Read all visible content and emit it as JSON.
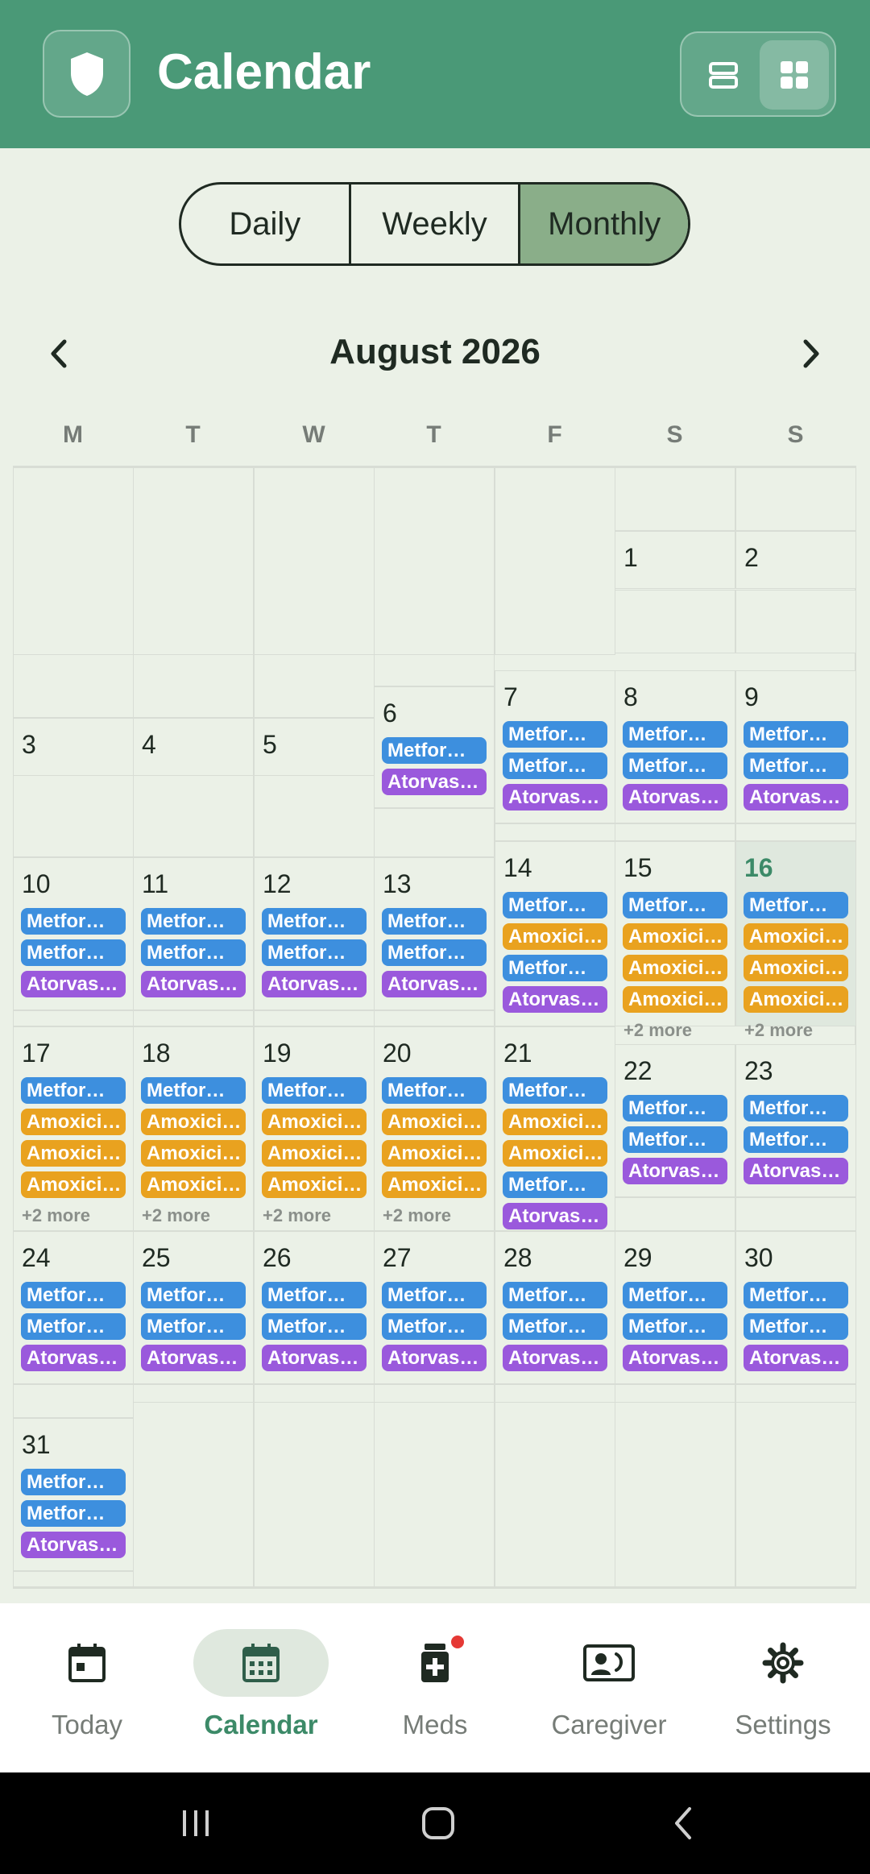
{
  "header": {
    "title": "Calendar",
    "logo_icon": "shield-icon",
    "view_toggle": [
      {
        "icon": "list-view-icon",
        "active": false
      },
      {
        "icon": "grid-view-icon",
        "active": true
      }
    ]
  },
  "segmented": {
    "options": [
      "Daily",
      "Weekly",
      "Monthly"
    ],
    "selected": "Monthly"
  },
  "month_nav": {
    "title": "August 2026",
    "prev_icon": "chevron-left-icon",
    "next_icon": "chevron-right-icon"
  },
  "weekdays": [
    "M",
    "T",
    "W",
    "T",
    "F",
    "S",
    "S"
  ],
  "colors": {
    "header": "#4a9977",
    "background": "#ebf1e7",
    "metformin": "#3d8fde",
    "amoxicillin": "#e9a21f",
    "atorvastatin": "#9a59dc",
    "today": "#3c8a68"
  },
  "calendar": {
    "today": "16",
    "days": [
      {
        "day": "1",
        "pills": [],
        "more": ""
      },
      {
        "day": "2",
        "pills": [],
        "more": ""
      },
      {
        "day": "3",
        "pills": [],
        "more": ""
      },
      {
        "day": "4",
        "pills": [],
        "more": ""
      },
      {
        "day": "5",
        "pills": [],
        "more": ""
      },
      {
        "day": "6",
        "pills": [
          {
            "label": "Metfor…",
            "color": "blue"
          },
          {
            "label": "Atorvas…",
            "color": "purple"
          }
        ],
        "more": ""
      },
      {
        "day": "7",
        "pills": [
          {
            "label": "Metfor…",
            "color": "blue"
          },
          {
            "label": "Metfor…",
            "color": "blue"
          },
          {
            "label": "Atorvas…",
            "color": "purple"
          }
        ],
        "more": ""
      },
      {
        "day": "8",
        "pills": [
          {
            "label": "Metfor…",
            "color": "blue"
          },
          {
            "label": "Metfor…",
            "color": "blue"
          },
          {
            "label": "Atorvas…",
            "color": "purple"
          }
        ],
        "more": ""
      },
      {
        "day": "9",
        "pills": [
          {
            "label": "Metfor…",
            "color": "blue"
          },
          {
            "label": "Metfor…",
            "color": "blue"
          },
          {
            "label": "Atorvas…",
            "color": "purple"
          }
        ],
        "more": ""
      },
      {
        "day": "10",
        "pills": [
          {
            "label": "Metfor…",
            "color": "blue"
          },
          {
            "label": "Metfor…",
            "color": "blue"
          },
          {
            "label": "Atorvas…",
            "color": "purple"
          }
        ],
        "more": ""
      },
      {
        "day": "11",
        "pills": [
          {
            "label": "Metfor…",
            "color": "blue"
          },
          {
            "label": "Metfor…",
            "color": "blue"
          },
          {
            "label": "Atorvas…",
            "color": "purple"
          }
        ],
        "more": ""
      },
      {
        "day": "12",
        "pills": [
          {
            "label": "Metfor…",
            "color": "blue"
          },
          {
            "label": "Metfor…",
            "color": "blue"
          },
          {
            "label": "Atorvas…",
            "color": "purple"
          }
        ],
        "more": ""
      },
      {
        "day": "13",
        "pills": [
          {
            "label": "Metfor…",
            "color": "blue"
          },
          {
            "label": "Metfor…",
            "color": "blue"
          },
          {
            "label": "Atorvas…",
            "color": "purple"
          }
        ],
        "more": ""
      },
      {
        "day": "14",
        "pills": [
          {
            "label": "Metfor…",
            "color": "blue"
          },
          {
            "label": "Amoxici…",
            "color": "orange"
          },
          {
            "label": "Metfor…",
            "color": "blue"
          },
          {
            "label": "Atorvas…",
            "color": "purple"
          }
        ],
        "more": ""
      },
      {
        "day": "15",
        "pills": [
          {
            "label": "Metfor…",
            "color": "blue"
          },
          {
            "label": "Amoxici…",
            "color": "orange"
          },
          {
            "label": "Amoxici…",
            "color": "orange"
          },
          {
            "label": "Amoxici…",
            "color": "orange"
          }
        ],
        "more": "+2 more"
      },
      {
        "day": "16",
        "pills": [
          {
            "label": "Metfor…",
            "color": "blue"
          },
          {
            "label": "Amoxici…",
            "color": "orange"
          },
          {
            "label": "Amoxici…",
            "color": "orange"
          },
          {
            "label": "Amoxici…",
            "color": "orange"
          }
        ],
        "more": "+2 more"
      },
      {
        "day": "17",
        "pills": [
          {
            "label": "Metfor…",
            "color": "blue"
          },
          {
            "label": "Amoxici…",
            "color": "orange"
          },
          {
            "label": "Amoxici…",
            "color": "orange"
          },
          {
            "label": "Amoxici…",
            "color": "orange"
          }
        ],
        "more": "+2 more"
      },
      {
        "day": "18",
        "pills": [
          {
            "label": "Metfor…",
            "color": "blue"
          },
          {
            "label": "Amoxici…",
            "color": "orange"
          },
          {
            "label": "Amoxici…",
            "color": "orange"
          },
          {
            "label": "Amoxici…",
            "color": "orange"
          }
        ],
        "more": "+2 more"
      },
      {
        "day": "19",
        "pills": [
          {
            "label": "Metfor…",
            "color": "blue"
          },
          {
            "label": "Amoxici…",
            "color": "orange"
          },
          {
            "label": "Amoxici…",
            "color": "orange"
          },
          {
            "label": "Amoxici…",
            "color": "orange"
          }
        ],
        "more": "+2 more"
      },
      {
        "day": "20",
        "pills": [
          {
            "label": "Metfor…",
            "color": "blue"
          },
          {
            "label": "Amoxici…",
            "color": "orange"
          },
          {
            "label": "Amoxici…",
            "color": "orange"
          },
          {
            "label": "Amoxici…",
            "color": "orange"
          }
        ],
        "more": "+2 more"
      },
      {
        "day": "21",
        "pills": [
          {
            "label": "Metfor…",
            "color": "blue"
          },
          {
            "label": "Amoxici…",
            "color": "orange"
          },
          {
            "label": "Amoxici…",
            "color": "orange"
          },
          {
            "label": "Metfor…",
            "color": "blue"
          },
          {
            "label": "Atorvas…",
            "color": "purple"
          }
        ],
        "more": ""
      },
      {
        "day": "22",
        "pills": [
          {
            "label": "Metfor…",
            "color": "blue"
          },
          {
            "label": "Metfor…",
            "color": "blue"
          },
          {
            "label": "Atorvas…",
            "color": "purple"
          }
        ],
        "more": ""
      },
      {
        "day": "23",
        "pills": [
          {
            "label": "Metfor…",
            "color": "blue"
          },
          {
            "label": "Metfor…",
            "color": "blue"
          },
          {
            "label": "Atorvas…",
            "color": "purple"
          }
        ],
        "more": ""
      },
      {
        "day": "24",
        "pills": [
          {
            "label": "Metfor…",
            "color": "blue"
          },
          {
            "label": "Metfor…",
            "color": "blue"
          },
          {
            "label": "Atorvas…",
            "color": "purple"
          }
        ],
        "more": ""
      },
      {
        "day": "25",
        "pills": [
          {
            "label": "Metfor…",
            "color": "blue"
          },
          {
            "label": "Metfor…",
            "color": "blue"
          },
          {
            "label": "Atorvas…",
            "color": "purple"
          }
        ],
        "more": ""
      },
      {
        "day": "26",
        "pills": [
          {
            "label": "Metfor…",
            "color": "blue"
          },
          {
            "label": "Metfor…",
            "color": "blue"
          },
          {
            "label": "Atorvas…",
            "color": "purple"
          }
        ],
        "more": ""
      },
      {
        "day": "27",
        "pills": [
          {
            "label": "Metfor…",
            "color": "blue"
          },
          {
            "label": "Metfor…",
            "color": "blue"
          },
          {
            "label": "Atorvas…",
            "color": "purple"
          }
        ],
        "more": ""
      },
      {
        "day": "28",
        "pills": [
          {
            "label": "Metfor…",
            "color": "blue"
          },
          {
            "label": "Metfor…",
            "color": "blue"
          },
          {
            "label": "Atorvas…",
            "color": "purple"
          }
        ],
        "more": ""
      },
      {
        "day": "29",
        "pills": [
          {
            "label": "Metfor…",
            "color": "blue"
          },
          {
            "label": "Metfor…",
            "color": "blue"
          },
          {
            "label": "Atorvas…",
            "color": "purple"
          }
        ],
        "more": ""
      },
      {
        "day": "30",
        "pills": [
          {
            "label": "Metfor…",
            "color": "blue"
          },
          {
            "label": "Metfor…",
            "color": "blue"
          },
          {
            "label": "Atorvas…",
            "color": "purple"
          }
        ],
        "more": ""
      },
      {
        "day": "31",
        "pills": [
          {
            "label": "Metfor…",
            "color": "blue"
          },
          {
            "label": "Metfor…",
            "color": "blue"
          },
          {
            "label": "Atorvas…",
            "color": "purple"
          }
        ],
        "more": ""
      }
    ]
  },
  "bottom_nav": {
    "active": "Calendar",
    "items": [
      {
        "label": "Today",
        "icon": "calendar-today-icon"
      },
      {
        "label": "Calendar",
        "icon": "calendar-month-icon"
      },
      {
        "label": "Meds",
        "icon": "medication-icon",
        "badge": true
      },
      {
        "label": "Caregiver",
        "icon": "caregiver-icon"
      },
      {
        "label": "Settings",
        "icon": "gear-icon"
      }
    ]
  },
  "system_nav": [
    {
      "icon": "recent-apps-icon"
    },
    {
      "icon": "home-icon"
    },
    {
      "icon": "back-icon"
    }
  ]
}
